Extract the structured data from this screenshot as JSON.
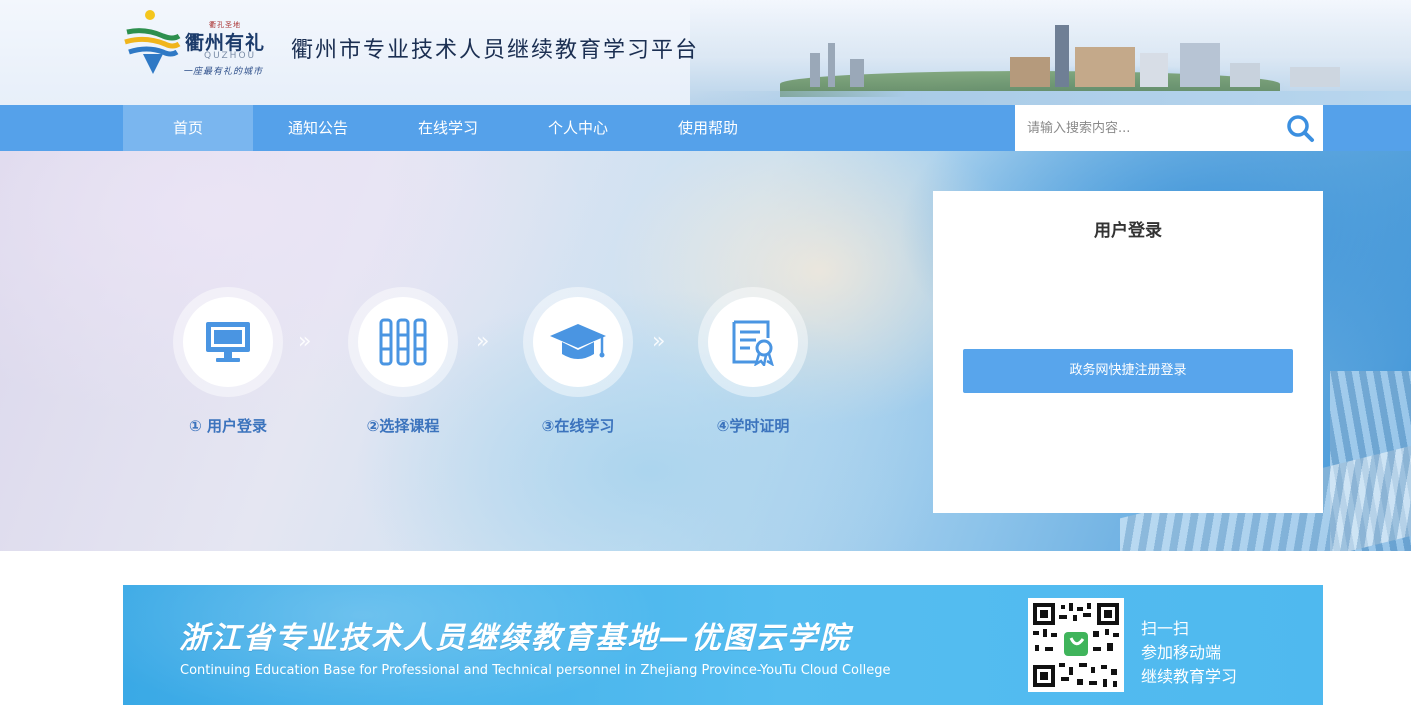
{
  "header": {
    "logo": {
      "seal_text": "衢孔圣地",
      "city_name": "衢州有礼",
      "city_en": "QUZHOU",
      "slogan": "一座最有礼的城市"
    },
    "site_title": "衢州市专业技术人员继续教育学习平台"
  },
  "nav": {
    "items": [
      {
        "label": "首页",
        "active": true
      },
      {
        "label": "通知公告",
        "active": false
      },
      {
        "label": "在线学习",
        "active": false
      },
      {
        "label": "个人中心",
        "active": false
      },
      {
        "label": "使用帮助",
        "active": false
      }
    ],
    "search": {
      "placeholder": "请输入搜索内容...",
      "icon": "search-icon"
    }
  },
  "banner": {
    "steps": [
      {
        "label": "① 用户登录",
        "icon": "monitor-icon"
      },
      {
        "label": "②选择课程",
        "icon": "course-shelf-icon"
      },
      {
        "label": "③在线学习",
        "icon": "graduation-cap-icon"
      },
      {
        "label": "④学时证明",
        "icon": "certificate-icon"
      }
    ]
  },
  "login": {
    "title": "用户登录",
    "register_button": "政务网快捷注册登录"
  },
  "promo": {
    "title": "浙江省专业技术人员继续教育基地—优图云学院",
    "subtitle": "Continuing Education Base for Professional and Technical personnel in Zhejiang Province-YouTu Cloud College",
    "scan_lines": [
      "扫一扫",
      "参加移动端",
      "继续教育学习"
    ]
  },
  "colors": {
    "nav_bg": "#55a1ea",
    "nav_active": "#7ab6ef",
    "accent_button": "#58a5ec",
    "step_label": "#3b73bd",
    "promo_bg": "#3aa9e6"
  }
}
